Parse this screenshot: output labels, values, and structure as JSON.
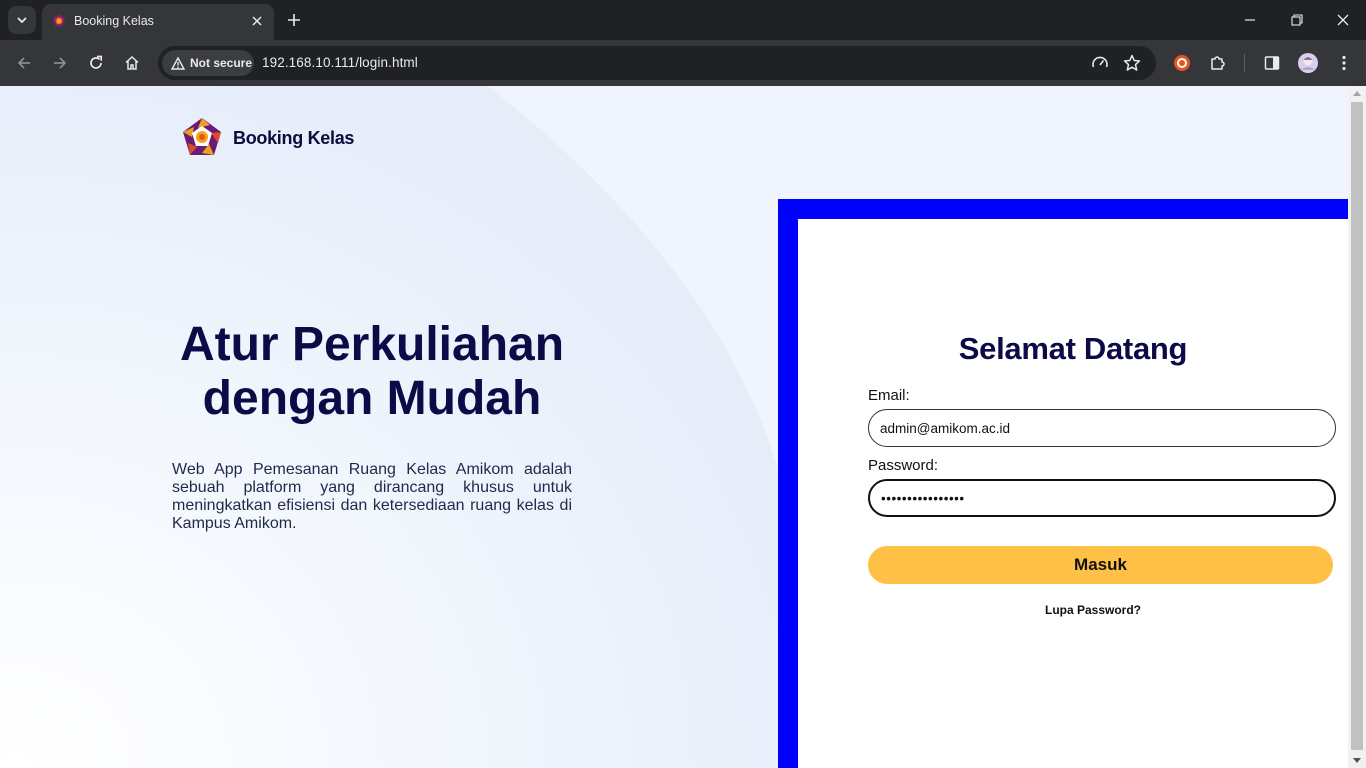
{
  "browser": {
    "tab_title": "Booking Kelas",
    "security_label": "Not secure",
    "url": "192.168.10.111/login.html"
  },
  "page": {
    "brand_name": "Booking Kelas",
    "hero_line1": "Atur Perkuliahan",
    "hero_line2": "dengan Mudah",
    "description": "Web App Pemesanan Ruang Kelas Amikom adalah sebuah platform yang dirancang khusus untuk meningkatkan efisiensi dan ketersediaan ruang kelas di Kampus Amikom.",
    "login": {
      "heading": "Selamat Datang",
      "email_label": "Email:",
      "email_value": "admin@amikom.ac.id",
      "password_label": "Password:",
      "password_value": "••••••••••••••••",
      "submit_label": "Masuk",
      "forgot_label": "Lupa Password?"
    }
  },
  "colors": {
    "frame_blue": "#0000ff",
    "button_yellow": "#ffc145",
    "heading_navy": "#0d0b47",
    "page_bg": "#f0f5fd"
  },
  "icons": [
    "chevron-down-icon",
    "app-favicon",
    "close-icon",
    "plus-icon",
    "minimize-icon",
    "restore-icon",
    "back-arrow-icon",
    "forward-arrow-icon",
    "reload-icon",
    "home-icon",
    "warning-icon",
    "performance-icon",
    "star-icon",
    "extension-shield-icon",
    "puzzle-icon",
    "sidebar-icon",
    "profile-avatar",
    "kebab-menu-icon"
  ]
}
